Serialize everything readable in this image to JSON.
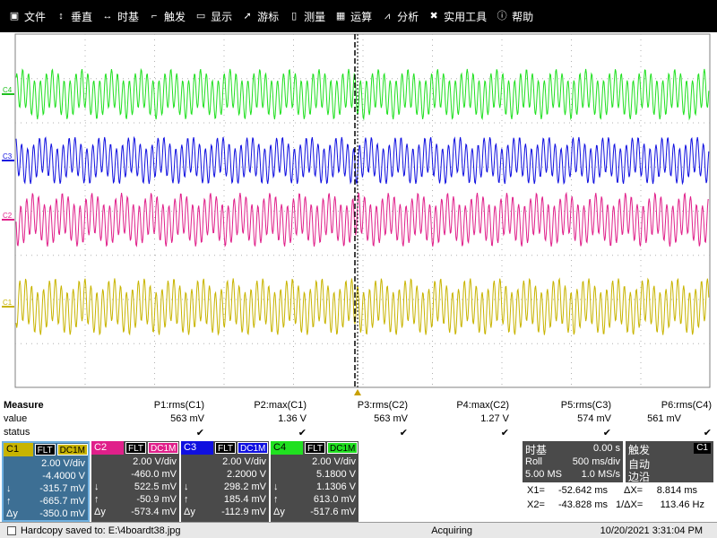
{
  "menu": [
    {
      "label": "文件",
      "icon": "file-icon"
    },
    {
      "label": "垂直",
      "icon": "vertical-arrow-icon"
    },
    {
      "label": "时基",
      "icon": "horizontal-arrow-icon"
    },
    {
      "label": "触发",
      "icon": "trigger-icon"
    },
    {
      "label": "显示",
      "icon": "display-icon"
    },
    {
      "label": "游标",
      "icon": "cursor-icon"
    },
    {
      "label": "测量",
      "icon": "measure-icon"
    },
    {
      "label": "运算",
      "icon": "calculator-icon"
    },
    {
      "label": "分析",
      "icon": "analysis-icon"
    },
    {
      "label": "实用工具",
      "icon": "tools-icon"
    },
    {
      "label": "帮助",
      "icon": "help-icon"
    }
  ],
  "channels_markers": {
    "c4": "C4",
    "c3": "C3",
    "c2": "C2",
    "c1": "C1"
  },
  "colors": {
    "c1": "#c8b400",
    "c2": "#e0208a",
    "c3": "#1010e0",
    "c4": "#20e020",
    "grid": "#b0b0b0"
  },
  "measure": {
    "title": "Measure",
    "value_label": "value",
    "status_label": "status",
    "columns": [
      {
        "name": "P1:rms(C1)",
        "value": "563 mV"
      },
      {
        "name": "P2:max(C1)",
        "value": "1.36 V"
      },
      {
        "name": "P3:rms(C2)",
        "value": "563 mV"
      },
      {
        "name": "P4:max(C2)",
        "value": "1.27 V"
      },
      {
        "name": "P5:rms(C3)",
        "value": "574 mV"
      },
      {
        "name": "P6:rms(C4)",
        "value": "561 mV"
      }
    ],
    "status_mark": "✔"
  },
  "channels": [
    {
      "name": "C1",
      "flt": "FLT",
      "dc": "DC1M",
      "vdiv": "2.00 V/div",
      "offset": "-4.4000 V",
      "down": "-315.7 mV",
      "up": "-665.7 mV",
      "dy": "-350.0 mV"
    },
    {
      "name": "C2",
      "flt": "FLT",
      "dc": "DC1M",
      "vdiv": "2.00 V/div",
      "offset": "-460.0 mV",
      "down": "522.5 mV",
      "up": "-50.9 mV",
      "dy": "-573.4 mV"
    },
    {
      "name": "C3",
      "flt": "FLT",
      "dc": "DC1M",
      "vdiv": "2.00 V/div",
      "offset": "2.2000 V",
      "down": "298.2 mV",
      "up": "185.4 mV",
      "dy": "-112.9 mV"
    },
    {
      "name": "C4",
      "flt": "FLT",
      "dc": "DC1M",
      "vdiv": "2.00 V/div",
      "offset": "5.1800 V",
      "down": "1.1306 V",
      "up": "613.0 mV",
      "dy": "-517.6 mV"
    }
  ],
  "row_symbols": {
    "down": "↓",
    "up": "↑",
    "dy": "Δy"
  },
  "timebase": {
    "title": "时基",
    "delay": "0.00 s",
    "mode": "Roll",
    "scale": "500 ms/div",
    "points": "5.00 MS",
    "rate": "1.0 MS/s"
  },
  "trigger": {
    "title": "触发",
    "source": "C1",
    "mode": "自动",
    "slope": "边沿"
  },
  "cursors": {
    "x1_label": "X1=",
    "x1": "-52.642 ms",
    "dx_label": "ΔX=",
    "dx": "8.814 ms",
    "x2_label": "X2=",
    "x2": "-43.828 ms",
    "inv_label": "1/ΔX=",
    "inv": "113.46 Hz"
  },
  "status": {
    "hardcopy": "Hardcopy saved to: E:\\4boardt38.jpg",
    "acq": "Acquiring",
    "datetime": "10/20/2021 3:31:04 PM"
  }
}
